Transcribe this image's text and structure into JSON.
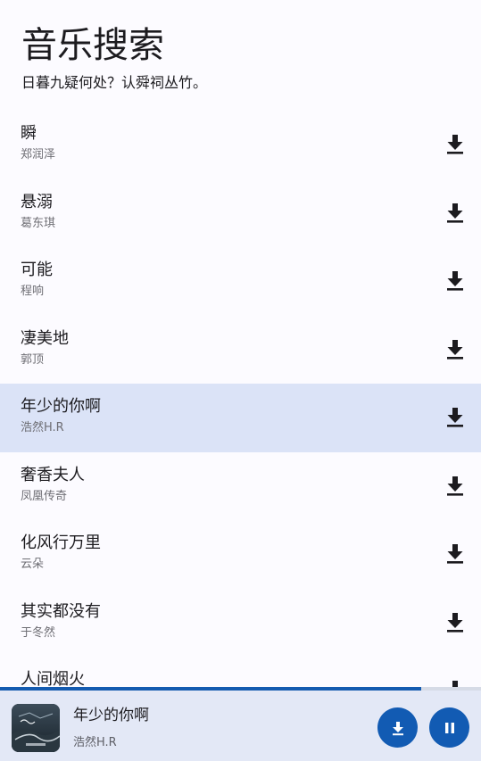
{
  "header": {
    "title": "音乐搜索",
    "subtitle": "日暮九疑何处？认舜祠丛竹。"
  },
  "songs": [
    {
      "title": "瞬",
      "artist": "郑润泽"
    },
    {
      "title": "悬溺",
      "artist": "葛东琪"
    },
    {
      "title": "可能",
      "artist": "程响"
    },
    {
      "title": "凄美地",
      "artist": "郭顶"
    },
    {
      "title": "年少的你啊",
      "artist": "浩然H.R"
    },
    {
      "title": "奢香夫人",
      "artist": "凤凰传奇"
    },
    {
      "title": "化风行万里",
      "artist": "云朵"
    },
    {
      "title": "其实都没有",
      "artist": "于冬然"
    },
    {
      "title": "人间烟火",
      "artist": ""
    }
  ],
  "active_song_index": 4,
  "player": {
    "title": "年少的你啊",
    "artist": "浩然H.R",
    "progress": 0.875,
    "download_icon": "download-icon",
    "pause_icon": "pause-icon"
  },
  "colors": {
    "accent": "#125bb3",
    "active_row": "#dbe3f7",
    "background": "#fcfbff",
    "player_bar": "#e3e8f6"
  }
}
